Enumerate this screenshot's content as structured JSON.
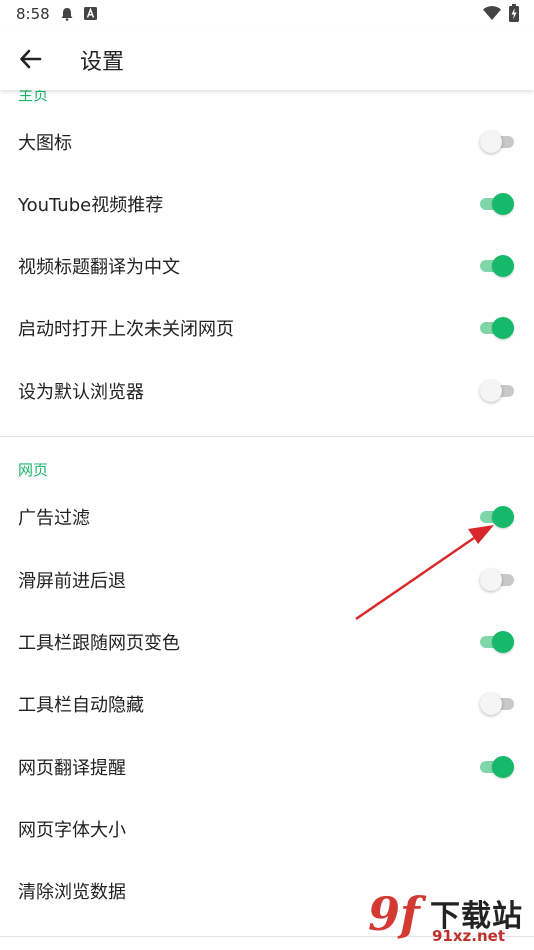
{
  "status_bar": {
    "time": "8:58",
    "icons": [
      "notification-bell-icon",
      "app-a-icon",
      "wifi-icon",
      "battery-charging-icon"
    ]
  },
  "app_bar": {
    "back_icon": "arrow-left-icon",
    "title": "设置"
  },
  "sections": {
    "home": {
      "header": "主页",
      "items": [
        {
          "label": "大图标",
          "toggle": false
        },
        {
          "label": "YouTube视频推荐",
          "toggle": true
        },
        {
          "label": "视频标题翻译为中文",
          "toggle": true
        },
        {
          "label": "启动时打开上次未关闭网页",
          "toggle": true
        },
        {
          "label": "设为默认浏览器",
          "toggle": false
        }
      ]
    },
    "web": {
      "header": "网页",
      "items": [
        {
          "label": "广告过滤",
          "toggle": true
        },
        {
          "label": "滑屏前进后退",
          "toggle": false
        },
        {
          "label": "工具栏跟随网页变色",
          "toggle": true
        },
        {
          "label": "工具栏自动隐藏",
          "toggle": false
        },
        {
          "label": "网页翻译提醒",
          "toggle": true
        },
        {
          "label": "网页字体大小"
        },
        {
          "label": "清除浏览数据"
        }
      ]
    }
  },
  "colors": {
    "accent": "#1db36b",
    "switch_on_thumb": "#16b86a",
    "switch_on_track": "#7fd6a8",
    "annotation_arrow": "#d9282a"
  },
  "watermark": {
    "logo": "9f",
    "title": "下载站",
    "url": "91xz.net"
  }
}
